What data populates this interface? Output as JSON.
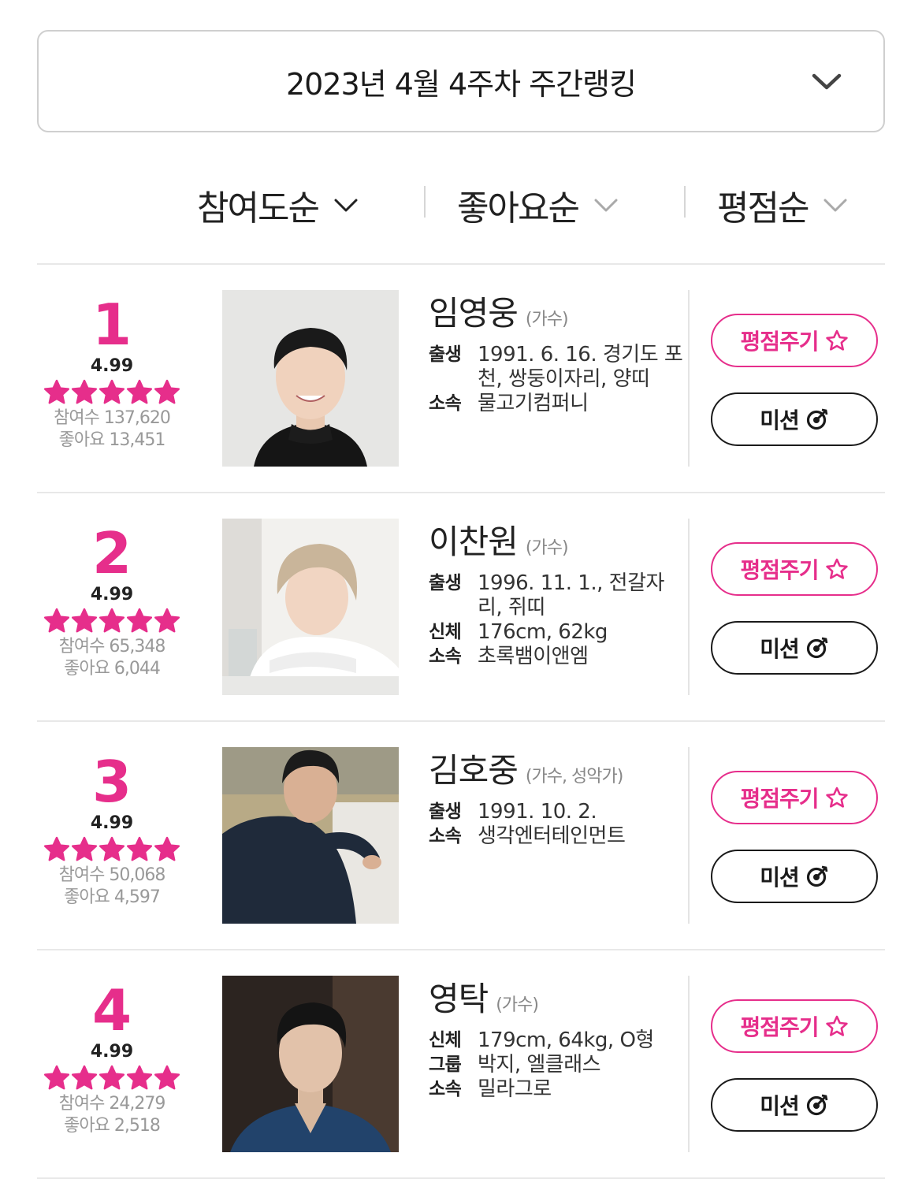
{
  "week_selector": {
    "label": "2023년 4월 4주차 주간랭킹",
    "icon": "chevron-down-icon"
  },
  "sort_tabs": [
    {
      "label": "참여도순",
      "active": true
    },
    {
      "label": "좋아요순",
      "active": false
    },
    {
      "label": "평점순",
      "active": false
    }
  ],
  "colors": {
    "accent": "#e62e8b",
    "text": "#222222",
    "muted": "#999999"
  },
  "buttons": {
    "rate_label": "평점주기",
    "mission_label": "미션",
    "rate_icon": "star-outline-icon",
    "mission_icon": "target-icon"
  },
  "rankings": [
    {
      "rank": "1",
      "score": "4.99",
      "rating": 5,
      "participants": "참여수 137,620",
      "likes": "좋아요 13,451",
      "name": "임영웅",
      "occupation": "(가수)",
      "details": [
        {
          "key": "출생",
          "value": "1991. 6. 16. 경기도 포천, 쌍둥이자리, 양띠"
        },
        {
          "key": "소속",
          "value": "물고기컴퍼니"
        }
      ]
    },
    {
      "rank": "2",
      "score": "4.99",
      "rating": 5,
      "participants": "참여수 65,348",
      "likes": "좋아요 6,044",
      "name": "이찬원",
      "occupation": "(가수)",
      "details": [
        {
          "key": "출생",
          "value": "1996. 11. 1., 전갈자리, 쥐띠"
        },
        {
          "key": "신체",
          "value": "176cm, 62kg"
        },
        {
          "key": "소속",
          "value": "초록뱀이앤엠"
        }
      ]
    },
    {
      "rank": "3",
      "score": "4.99",
      "rating": 5,
      "participants": "참여수 50,068",
      "likes": "좋아요 4,597",
      "name": "김호중",
      "occupation": "(가수, 성악가)",
      "details": [
        {
          "key": "출생",
          "value": "1991. 10. 2."
        },
        {
          "key": "소속",
          "value": "생각엔터테인먼트"
        }
      ]
    },
    {
      "rank": "4",
      "score": "4.99",
      "rating": 5,
      "participants": "참여수 24,279",
      "likes": "좋아요 2,518",
      "name": "영탁",
      "occupation": "(가수)",
      "details": [
        {
          "key": "신체",
          "value": "179cm, 64kg, O형"
        },
        {
          "key": "그룹",
          "value": "박지, 엘클래스"
        },
        {
          "key": "소속",
          "value": "밀라그로"
        }
      ]
    }
  ]
}
